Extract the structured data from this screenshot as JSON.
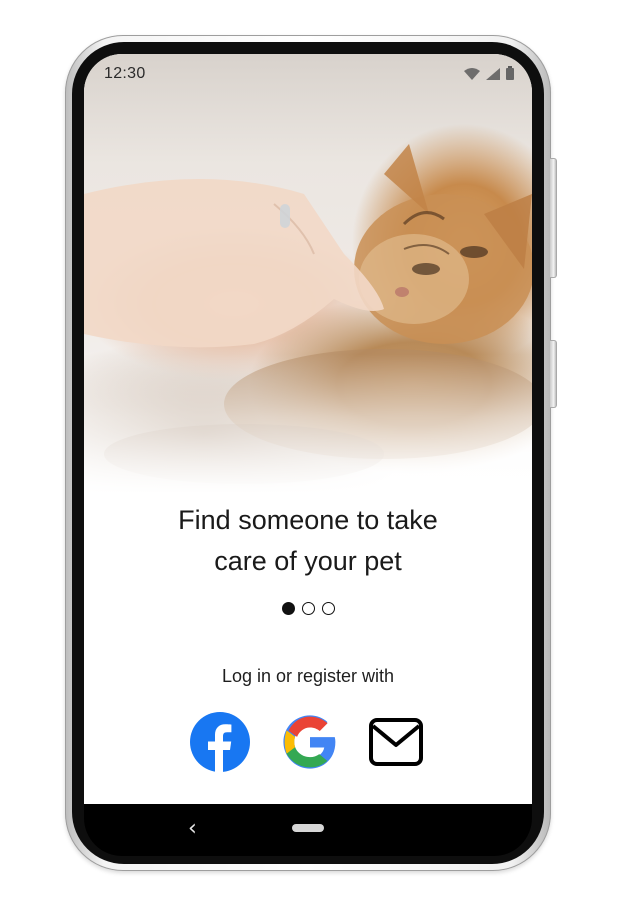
{
  "status_bar": {
    "time": "12:30",
    "icons": [
      "wifi-icon",
      "signal-icon",
      "battery-icon"
    ]
  },
  "onboarding": {
    "title_line1": "Find someone to take",
    "title_line2": "care of your pet",
    "pager": {
      "total": 3,
      "active": 1
    },
    "login_label": "Log in or register with",
    "social": [
      {
        "name": "facebook",
        "icon": "facebook-icon",
        "color": "#1877F2"
      },
      {
        "name": "google",
        "icon": "google-icon",
        "colors": [
          "#4285F4",
          "#34A853",
          "#FBBC05",
          "#EA4335"
        ]
      },
      {
        "name": "email",
        "icon": "mail-icon",
        "color": "#000000"
      }
    ]
  },
  "nav_bar": {
    "icons": [
      "back-chevron-icon",
      "home-pill"
    ]
  }
}
